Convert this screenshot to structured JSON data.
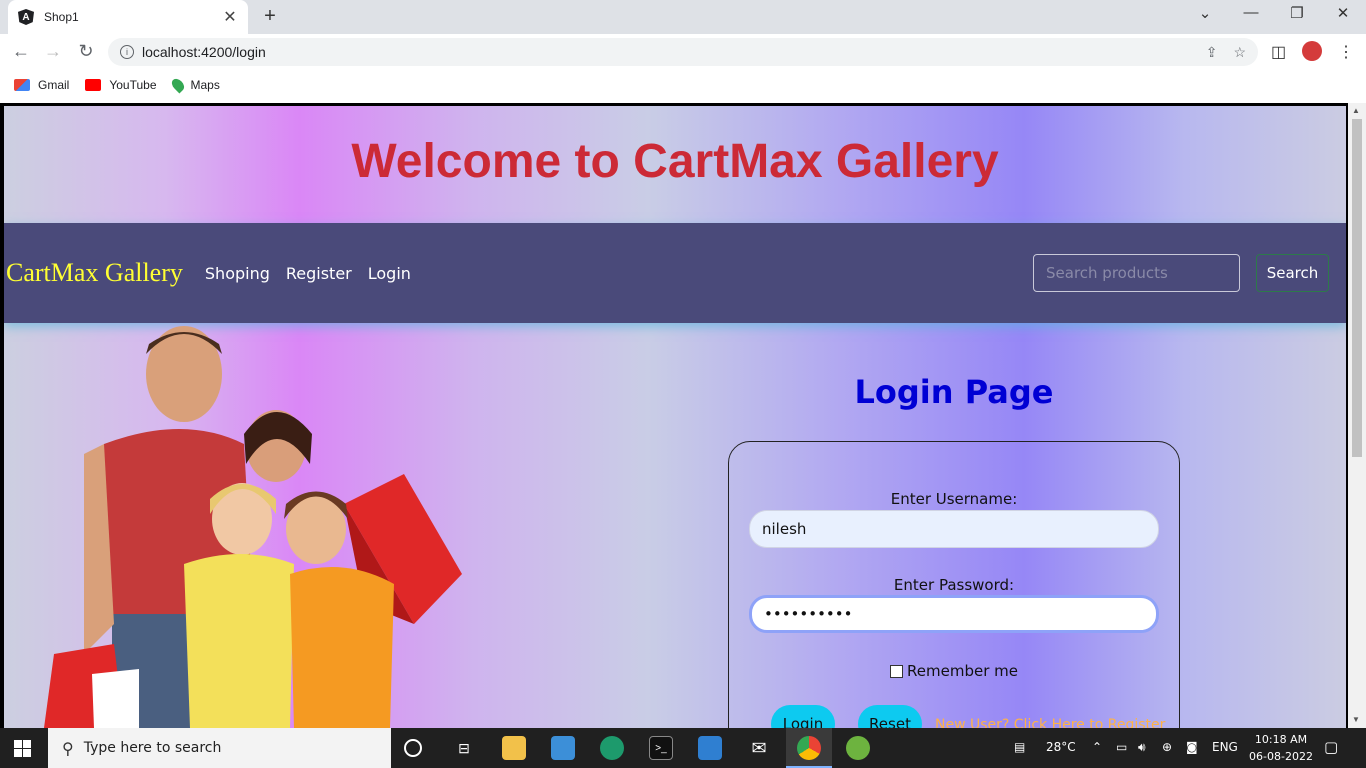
{
  "browser": {
    "tab_title": "Shop1",
    "tab_close": "✕",
    "new_tab": "+",
    "url": "localhost:4200/login",
    "bookmarks": [
      {
        "label": "Gmail",
        "color": "#ea4335"
      },
      {
        "label": "YouTube",
        "color": "#ff0000"
      },
      {
        "label": "Maps",
        "color": "#34a853"
      }
    ]
  },
  "page": {
    "welcome": "Welcome to CartMax Gallery",
    "brand": "CartMax Gallery",
    "nav_links": [
      "Shoping",
      "Register",
      "Login"
    ],
    "search_placeholder": "Search products",
    "search_button": "Search"
  },
  "login": {
    "title": "Login Page",
    "username_label": "Enter Username:",
    "username_value": "nilesh",
    "password_label": "Enter Password:",
    "password_value": "••••••••••",
    "remember_label": "Remember me",
    "login_button": "Login",
    "reset_button": "Reset",
    "register_link": "New User? Click Here to Register"
  },
  "taskbar": {
    "search_placeholder": "Type here to search",
    "weather": "28°C",
    "language": "ENG",
    "time": "10:18 AM",
    "date": "06-08-2022"
  },
  "colors": {
    "welcome": "#cc2a36",
    "navbar": "#4a4a7a",
    "brand": "#ffff33",
    "login_title": "#0000d4",
    "buttons": "#0dcaf0",
    "register_link": "#ffb347"
  }
}
